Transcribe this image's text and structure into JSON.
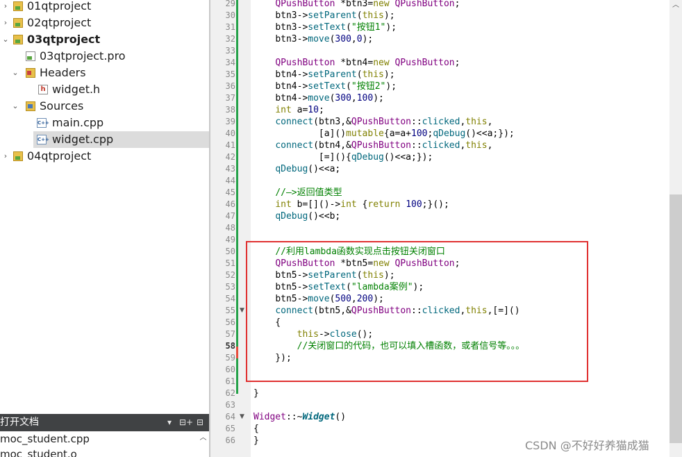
{
  "project_tree": {
    "items": [
      {
        "label": "01qtproject",
        "expanded": false
      },
      {
        "label": "02qtproject",
        "expanded": false
      },
      {
        "label": "03qtproject",
        "expanded": true,
        "bold": true
      },
      {
        "label": "03qtproject.pro"
      },
      {
        "label": "Headers",
        "expanded": true
      },
      {
        "label": "widget.h"
      },
      {
        "label": "Sources",
        "expanded": true
      },
      {
        "label": "main.cpp"
      },
      {
        "label": "widget.cpp",
        "selected": true
      },
      {
        "label": "04qtproject",
        "expanded": false
      }
    ]
  },
  "open_documents": {
    "title": "打开文档",
    "items": [
      "moc_student.cpp",
      "moc_student.o"
    ]
  },
  "editor": {
    "current_line": 58,
    "lines": [
      {
        "n": "29",
        "text": "    QPushButton *btn3=new QPushButton;"
      },
      {
        "n": "30",
        "text": "    btn3->setParent(this);"
      },
      {
        "n": "31",
        "text": "    btn3->setText(\"按钮1\");"
      },
      {
        "n": "32",
        "text": "    btn3->move(300,0);"
      },
      {
        "n": "33",
        "text": ""
      },
      {
        "n": "34",
        "text": "    QPushButton *btn4=new QPushButton;"
      },
      {
        "n": "35",
        "text": "    btn4->setParent(this);"
      },
      {
        "n": "36",
        "text": "    btn4->setText(\"按钮2\");"
      },
      {
        "n": "37",
        "text": "    btn4->move(300,100);"
      },
      {
        "n": "38",
        "text": "    int a=10;"
      },
      {
        "n": "39",
        "text": "    connect(btn3,&QPushButton::clicked,this,"
      },
      {
        "n": "40",
        "text": "            [a]()mutable{a=a+100;qDebug()<<a;});"
      },
      {
        "n": "41",
        "text": "    connect(btn4,&QPushButton::clicked,this,"
      },
      {
        "n": "42",
        "text": "            [=](){qDebug()<<a;});"
      },
      {
        "n": "43",
        "text": "    qDebug()<<a;"
      },
      {
        "n": "44",
        "text": ""
      },
      {
        "n": "45",
        "text": "    //—>返回值类型"
      },
      {
        "n": "46",
        "text": "    int b=[]()->int {return 100;}();"
      },
      {
        "n": "47",
        "text": "    qDebug()<<b;"
      },
      {
        "n": "48",
        "text": ""
      },
      {
        "n": "49",
        "text": ""
      },
      {
        "n": "50",
        "text": "    //利用lambda函数实现点击按钮关闭窗口"
      },
      {
        "n": "51",
        "text": "    QPushButton *btn5=new QPushButton;"
      },
      {
        "n": "52",
        "text": "    btn5->setParent(this);"
      },
      {
        "n": "53",
        "text": "    btn5->setText(\"lambda案例\");"
      },
      {
        "n": "54",
        "text": "    btn5->move(500,200);"
      },
      {
        "n": "55",
        "text": "    connect(btn5,&QPushButton::clicked,this,[=]()",
        "fold": true
      },
      {
        "n": "56",
        "text": "    {"
      },
      {
        "n": "57",
        "text": "        this->close();"
      },
      {
        "n": "58",
        "text": "        //关闭窗口的代码，也可以填入槽函数，或者信号等。。。"
      },
      {
        "n": "59",
        "text": "    });"
      },
      {
        "n": "60",
        "text": ""
      },
      {
        "n": "61",
        "text": ""
      },
      {
        "n": "62",
        "text": "}"
      },
      {
        "n": "63",
        "text": ""
      },
      {
        "n": "64",
        "text": "Widget::~Widget()",
        "fold": true
      },
      {
        "n": "65",
        "text": "{"
      },
      {
        "n": "66",
        "text": "}"
      }
    ]
  },
  "watermark": "CSDN @不好好养猫成猫",
  "colors": {
    "highlight_box": "#e03030",
    "modified_bar": "#24a148",
    "selection": "#dcdcdc"
  }
}
